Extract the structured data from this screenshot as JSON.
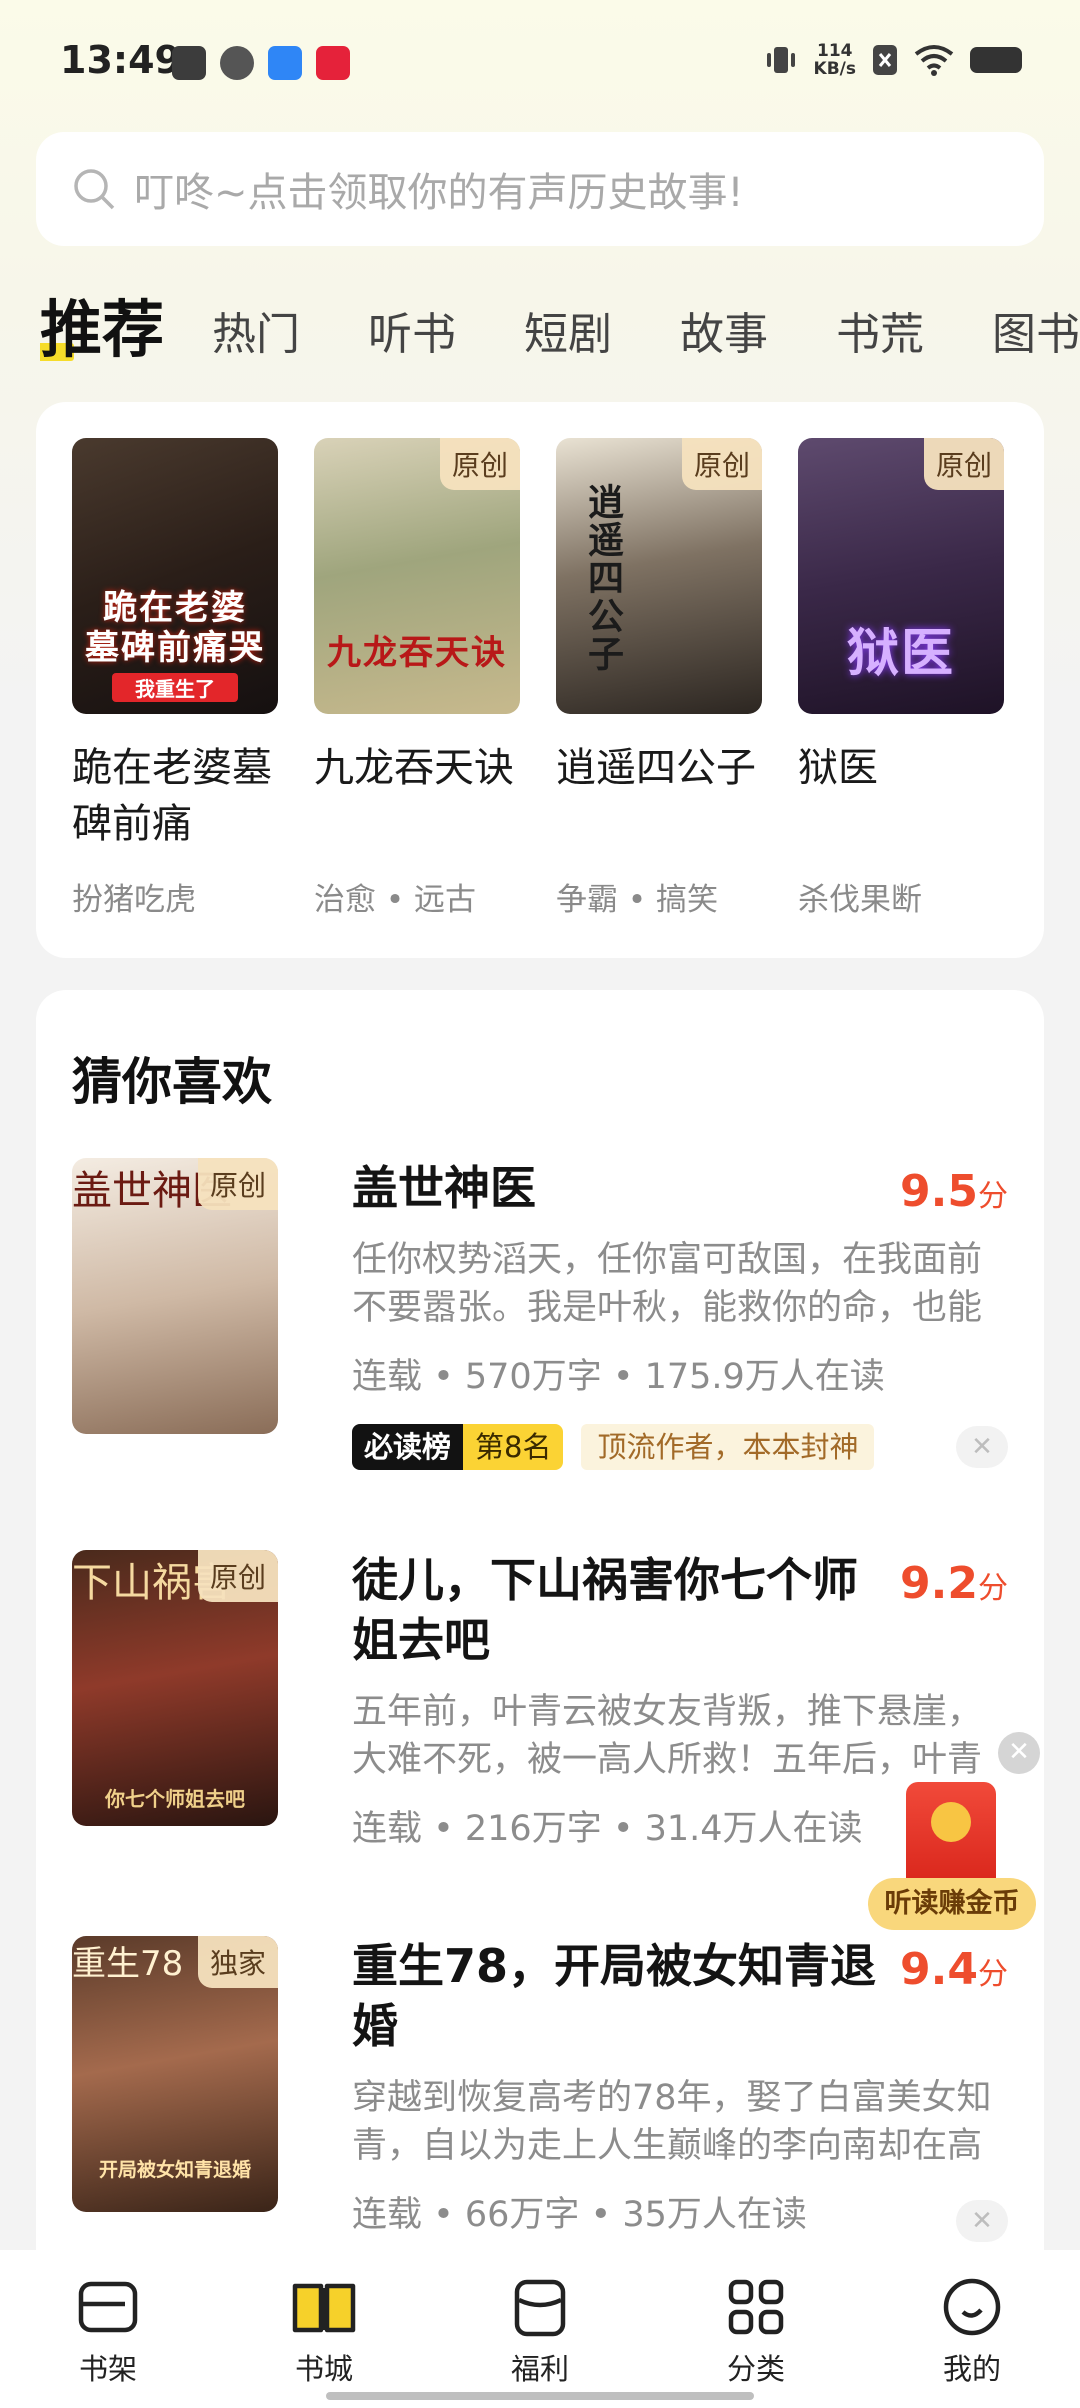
{
  "status_bar": {
    "time": "13:49",
    "net_speed_value": "114",
    "net_speed_unit": "KB/s"
  },
  "search": {
    "placeholder": "叮咚~点击领取你的有声历史故事!"
  },
  "tabs": [
    "推荐",
    "热门",
    "听书",
    "短剧",
    "故事",
    "书荒",
    "图书"
  ],
  "recommend": [
    {
      "title": "跪在老婆墓碑前痛",
      "tags": "扮猪吃虎",
      "badge": "",
      "cover_text": "跪在老婆\n墓碑前痛哭",
      "cover_sub": "我重生了"
    },
    {
      "title": "九龙吞天诀",
      "tags": "治愈 • 远古",
      "badge": "原创",
      "cover_text": "九龙吞天诀",
      "cover_sub": ""
    },
    {
      "title": "逍遥四公子",
      "tags": "争霸 • 搞笑",
      "badge": "原创",
      "cover_text": "逍遥四公子",
      "cover_sub": ""
    },
    {
      "title": "狱医",
      "tags": "杀伐果断",
      "badge": "原创",
      "cover_text": "狱医",
      "cover_sub": ""
    }
  ],
  "guess": {
    "heading": "猜你喜欢",
    "books": [
      {
        "title": "盖世神医",
        "score": "9.5",
        "score_unit": "分",
        "badge": "原创",
        "cover_text": "盖世神医",
        "desc": "任你权势滔天，任你富可敌国，在我面前不要嚣张。我是叶秋，能救你的命，也能要…",
        "meta": "连载 • 570万字 • 175.9万人在读",
        "rank_label": "必读榜",
        "rank_value": "第8名",
        "tagline": "顶流作者，本本封神"
      },
      {
        "title": "徒儿，下山祸害你七个师姐去吧",
        "score": "9.2",
        "score_unit": "分",
        "badge": "原创",
        "cover_text": "下山祸害",
        "cover_sub": "你七个师姐去吧",
        "desc": "五年前，叶青云被女友背叛，推下悬崖，大难不死，被一高人所救！五年后，叶青云…",
        "meta": "连载 • 216万字 • 31.4万人在读"
      },
      {
        "title": "重生78，开局被女知青退婚",
        "score": "9.4",
        "score_unit": "分",
        "badge": "独家",
        "cover_text": "重生78",
        "cover_sub": "开局被女知青退婚",
        "desc": "穿越到恢复高考的78年，娶了白富美女知青，自以为走上人生巅峰的李向南却在高考前…",
        "meta": "连载 • 66万字 • 35万人在读"
      }
    ]
  },
  "float_widget": {
    "label": "听读赚金币"
  },
  "bottom_nav": [
    {
      "label": "书架",
      "icon": "bookshelf-icon"
    },
    {
      "label": "书城",
      "icon": "open-book-icon"
    },
    {
      "label": "福利",
      "icon": "gift-icon"
    },
    {
      "label": "分类",
      "icon": "grid-icon"
    },
    {
      "label": "我的",
      "icon": "smile-icon"
    }
  ],
  "colors": {
    "accent_yellow": "#f6dc2a",
    "score_red": "#ee4d2d"
  }
}
